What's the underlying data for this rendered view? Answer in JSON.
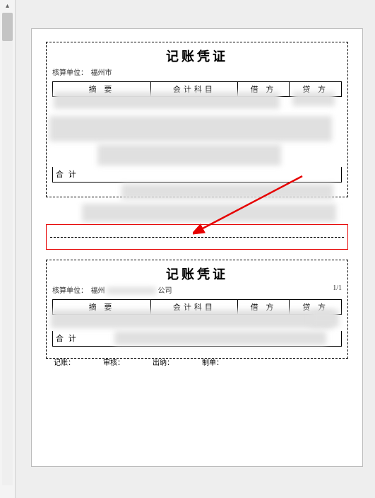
{
  "scrollbar": {
    "up_glyph": "▴",
    "down_glyph": "▾"
  },
  "voucher1": {
    "title": "记账凭证",
    "org_label": "核算单位：",
    "org_value": "福州市",
    "columns": {
      "summary": "摘 要",
      "subject": "会计科目",
      "debit": "借 方",
      "credit": "贷 方"
    },
    "total_label": "合 计"
  },
  "separator": {
    "note": ""
  },
  "voucher2": {
    "title": "记账凭证",
    "org_label": "核算单位：",
    "org_value": "福州",
    "org_suffix": "公司",
    "page_no": "1/1",
    "columns": {
      "summary": "摘 要",
      "subject": "会计科目",
      "debit": "借 方",
      "credit": "贷 方"
    },
    "total_label": "合 计",
    "footer": {
      "recorder": "记账：",
      "auditor": "审核：",
      "cashier": "出纳：",
      "preparer": "制单："
    }
  }
}
